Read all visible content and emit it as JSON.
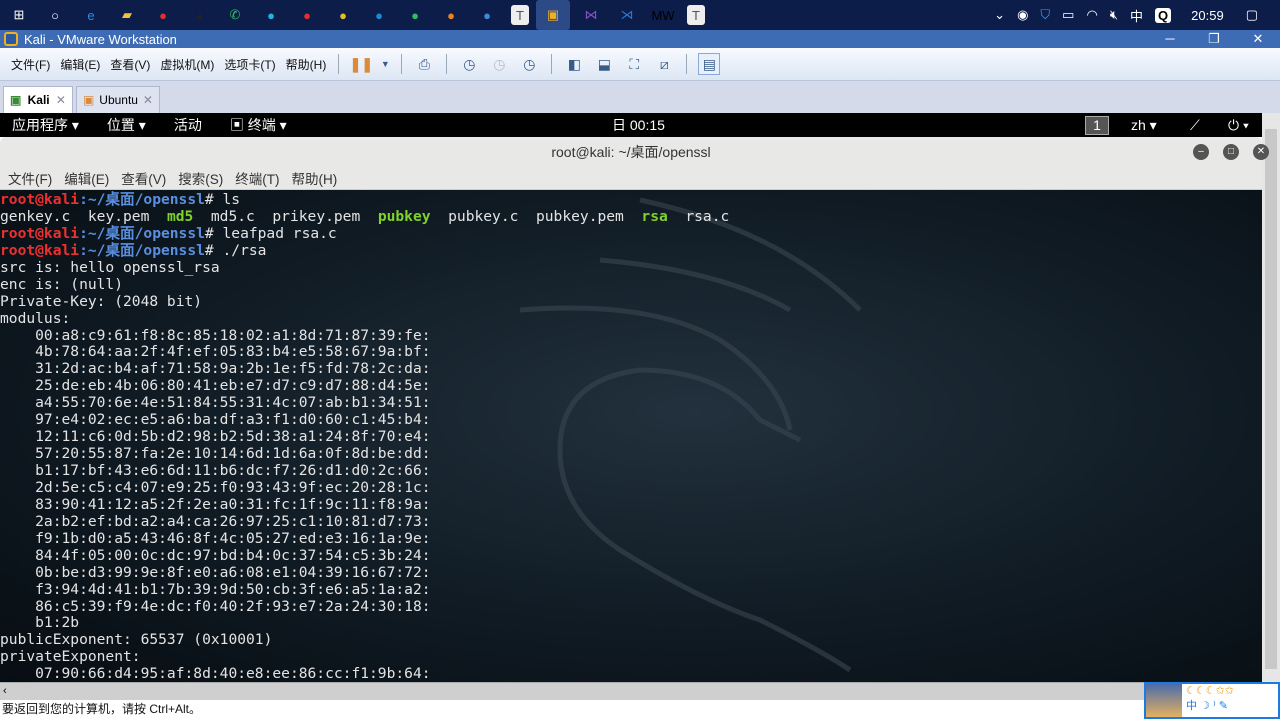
{
  "taskbar": {
    "icons": [
      "windows-start",
      "cortana",
      "edge",
      "file-explorer",
      "app-red",
      "qq",
      "wechat",
      "app-teal",
      "netease-music",
      "app-yellow",
      "app-blue",
      "evernote",
      "app-flame",
      "app-vs-blue",
      "typora",
      "vmware",
      "visual-studio",
      "vscode",
      "app-mw",
      "typora-2"
    ],
    "tray": {
      "lang": "中",
      "time": "20:59"
    }
  },
  "window": {
    "title": "Kali - VMware Workstation"
  },
  "menu": [
    "文件(F)",
    "编辑(E)",
    "查看(V)",
    "虚拟机(M)",
    "选项卡(T)",
    "帮助(H)"
  ],
  "tabs": [
    {
      "label": "Kali"
    },
    {
      "label": "Ubuntu"
    }
  ],
  "kali_bar": {
    "applications": "应用程序 ▾",
    "places": "位置 ▾",
    "activities": "活动",
    "terminal": "终端 ▾",
    "clock": "日 00:15",
    "workspace": "1",
    "lang": "zh ▾"
  },
  "terminal": {
    "title": "root@kali: ~/桌面/openssl",
    "menu": [
      "文件(F)",
      "编辑(E)",
      "查看(V)",
      "搜索(S)",
      "终端(T)",
      "帮助(H)"
    ],
    "prompt_user": "root@kali",
    "prompt_path": ":~/桌面/openssl",
    "cmd1": "# ls",
    "ls": [
      {
        "t": "genkey.c  ",
        "c": ""
      },
      {
        "t": "key.pem  ",
        "c": ""
      },
      {
        "t": "md5",
        "c": "grn"
      },
      {
        "t": "  md5.c  prikey.pem  ",
        "c": ""
      },
      {
        "t": "pubkey",
        "c": "grn"
      },
      {
        "t": "  pubkey.c  pubkey.pem  ",
        "c": ""
      },
      {
        "t": "rsa",
        "c": "grn"
      },
      {
        "t": "  rsa.c",
        "c": ""
      }
    ],
    "cmd2": "# leafpad rsa.c",
    "cmd3": "# ./rsa",
    "output": [
      "src is: hello openssl_rsa",
      "enc is: (null)",
      "Private-Key: (2048 bit)",
      "modulus:",
      "    00:a8:c9:61:f8:8c:85:18:02:a1:8d:71:87:39:fe:",
      "    4b:78:64:aa:2f:4f:ef:05:83:b4:e5:58:67:9a:bf:",
      "    31:2d:ac:b4:af:71:58:9a:2b:1e:f5:fd:78:2c:da:",
      "    25:de:eb:4b:06:80:41:eb:e7:d7:c9:d7:88:d4:5e:",
      "    a4:55:70:6e:4e:51:84:55:31:4c:07:ab:b1:34:51:",
      "    97:e4:02:ec:e5:a6:ba:df:a3:f1:d0:60:c1:45:b4:",
      "    12:11:c6:0d:5b:d2:98:b2:5d:38:a1:24:8f:70:e4:",
      "    57:20:55:87:fa:2e:10:14:6d:1d:6a:0f:8d:be:dd:",
      "    b1:17:bf:43:e6:6d:11:b6:dc:f7:26:d1:d0:2c:66:",
      "    2d:5e:c5:c4:07:e9:25:f0:93:43:9f:ec:20:28:1c:",
      "    83:90:41:12:a5:2f:2e:a0:31:fc:1f:9c:11:f8:9a:",
      "    2a:b2:ef:bd:a2:a4:ca:26:97:25:c1:10:81:d7:73:",
      "    f9:1b:d0:a5:43:46:8f:4c:05:27:ed:e3:16:1a:9e:",
      "    84:4f:05:00:0c:dc:97:bd:b4:0c:37:54:c5:3b:24:",
      "    0b:be:d3:99:9e:8f:e0:a6:08:e1:04:39:16:67:72:",
      "    f3:94:4d:41:b1:7b:39:9d:50:cb:3f:e6:a5:1a:a2:",
      "    86:c5:39:f9:4e:dc:f0:40:2f:93:e7:2a:24:30:18:",
      "    b1:2b",
      "publicExponent: 65537 (0x10001)",
      "privateExponent:",
      "    07:90:66:d4:95:af:8d:40:e8:ee:86:cc:f1:9b:64:"
    ]
  },
  "status": "要返回到您的计算机，请按 Ctrl+Alt。",
  "ime": {
    "label": "中"
  }
}
